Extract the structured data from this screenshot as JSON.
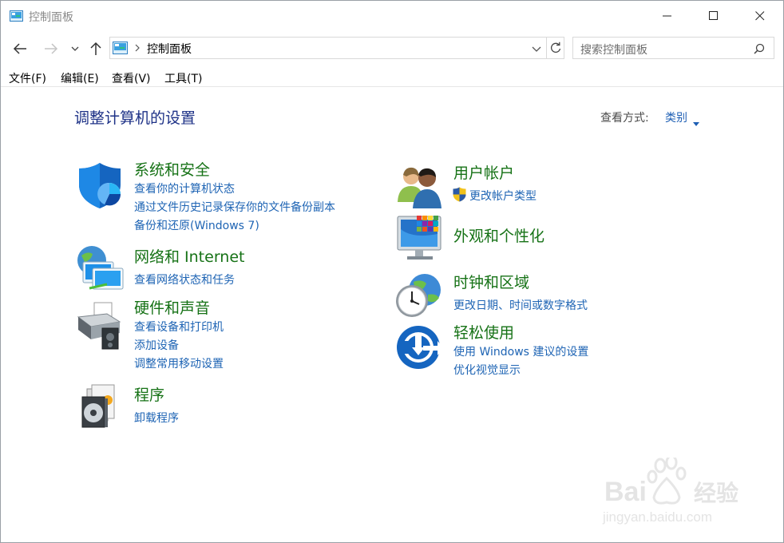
{
  "window": {
    "title": "控制面板"
  },
  "address": {
    "path_item": "控制面板"
  },
  "search": {
    "placeholder": "搜索控制面板"
  },
  "menu": {
    "items": [
      "文件(F)",
      "编辑(E)",
      "查看(V)",
      "工具(T)"
    ]
  },
  "main": {
    "heading": "调整计算机的设置",
    "view_by_label": "查看方式:",
    "view_by_value": "类别"
  },
  "categories": [
    {
      "title": "系统和安全",
      "icon": "shield-icon",
      "links": [
        "查看你的计算机状态",
        "通过文件历史记录保存你的文件备份副本",
        "备份和还原(Windows 7)"
      ]
    },
    {
      "title": "网络和 Internet",
      "icon": "network-icon",
      "links": [
        "查看网络状态和任务"
      ]
    },
    {
      "title": "硬件和声音",
      "icon": "printer-icon",
      "links": [
        "查看设备和打印机",
        "添加设备",
        "调整常用移动设置"
      ]
    },
    {
      "title": "程序",
      "icon": "programs-icon",
      "links": [
        "卸载程序"
      ]
    },
    {
      "title": "用户帐户",
      "icon": "users-icon",
      "links": [
        "更改帐户类型"
      ]
    },
    {
      "title": "外观和个性化",
      "icon": "monitor-icon",
      "links": []
    },
    {
      "title": "时钟和区域",
      "icon": "clock-globe-icon",
      "links": [
        "更改日期、时间或数字格式"
      ]
    },
    {
      "title": "轻松使用",
      "icon": "ease-of-access-icon",
      "links": [
        "使用 Windows 建议的设置",
        "优化视觉显示"
      ]
    }
  ],
  "watermark": {
    "brand": "Baidu经验",
    "url": "jingyan.baidu.com"
  },
  "colors": {
    "category_title": "#167216",
    "link": "#1e64b4",
    "heading": "#1e3287",
    "border": "#d9d9d9"
  }
}
